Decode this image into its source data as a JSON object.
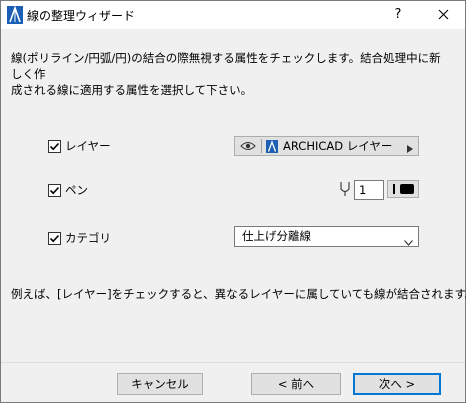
{
  "window": {
    "title": "線の整理ウィザード",
    "help_label": "?"
  },
  "intro_text": "線(ポリライン/円弧/円)の結合の際無視する属性をチェックします。結合処理中に新しく作\n成される線に適用する属性を選択して下さい。",
  "attributes": {
    "layer": {
      "label": "レイヤー",
      "checked": true,
      "value": "ARCHICAD レイヤー"
    },
    "pen": {
      "label": "ペン",
      "checked": true,
      "number": "1"
    },
    "category": {
      "label": "カテゴリ",
      "checked": true,
      "value": "仕上げ分離線"
    }
  },
  "example_text": "例えば、[レイヤー]をチェックすると、異なるレイヤーに属していても線が結合されます。",
  "buttons": {
    "cancel": "キャンセル",
    "back": "< 前へ",
    "next": "次へ >"
  },
  "colors": {
    "accent": "#0078d7",
    "panel": "#f0f0f0",
    "layer_icon": "#1a5fb4"
  }
}
